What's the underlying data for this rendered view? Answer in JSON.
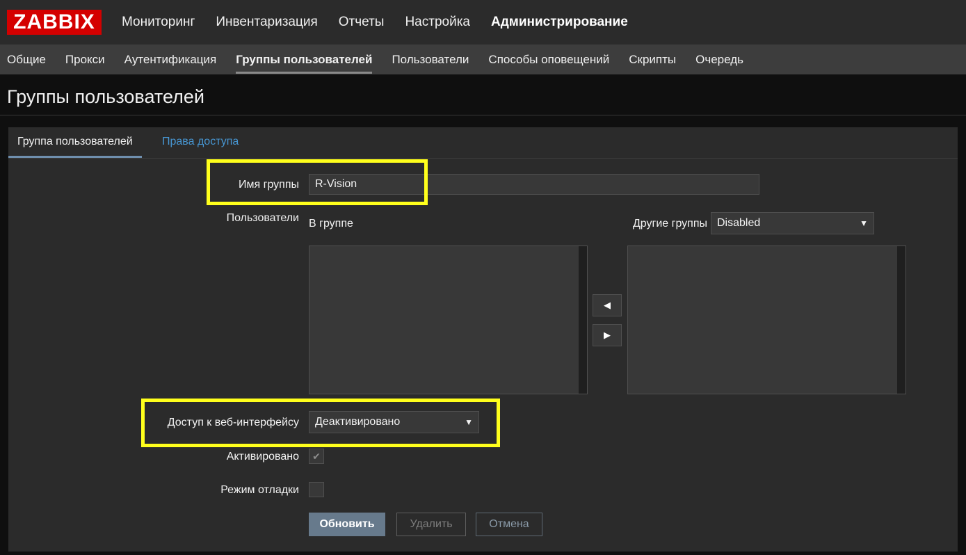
{
  "logo": "ZABBIX",
  "main_nav": [
    {
      "label": "Мониторинг"
    },
    {
      "label": "Инвентаризация"
    },
    {
      "label": "Отчеты"
    },
    {
      "label": "Настройка"
    },
    {
      "label": "Администрирование"
    }
  ],
  "sub_nav": [
    {
      "label": "Общие"
    },
    {
      "label": "Прокси"
    },
    {
      "label": "Аутентификация"
    },
    {
      "label": "Группы пользователей"
    },
    {
      "label": "Пользователи"
    },
    {
      "label": "Способы оповещений"
    },
    {
      "label": "Скрипты"
    },
    {
      "label": "Очередь"
    }
  ],
  "page_title": "Группы пользователей",
  "tabs": {
    "group": "Группа пользователей",
    "rights": "Права доступа"
  },
  "form": {
    "group_name_label": "Имя группы",
    "group_name_value": "R-Vision",
    "users_label": "Пользователи",
    "in_group_label": "В группе",
    "other_groups_label": "Другие группы",
    "other_groups_value": "Disabled",
    "frontend_access_label": "Доступ к веб-интерфейсу",
    "frontend_access_value": "Деактивировано",
    "enabled_label": "Активировано",
    "enabled_checked": true,
    "debug_label": "Режим отладки",
    "debug_checked": false
  },
  "buttons": {
    "update": "Обновить",
    "delete": "Удалить",
    "cancel": "Отмена"
  },
  "colors": {
    "highlight": "#ffff1c",
    "brand": "#d40000",
    "link": "#4796d2",
    "primary_button": "#677a8c"
  }
}
